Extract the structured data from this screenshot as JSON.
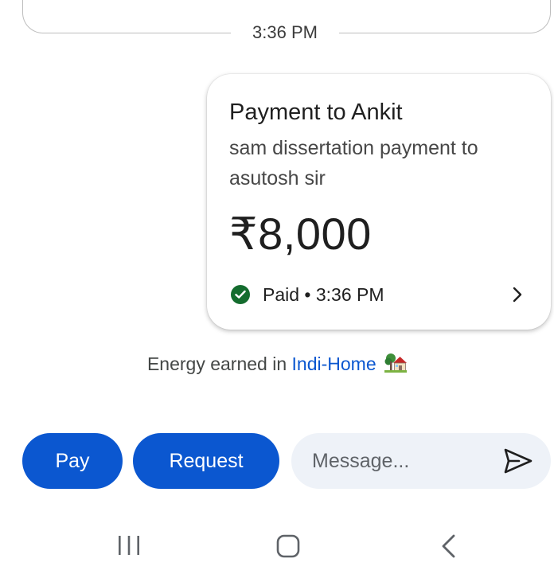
{
  "timestamp": "3:36 PM",
  "payment_card": {
    "title": "Payment to Ankit",
    "note": "sam dissertation payment to asutosh sir",
    "amount": "₹8,000",
    "status": "Paid • 3:36 PM",
    "status_icon": "check-circle-icon",
    "status_color": "#146c2e"
  },
  "energy": {
    "prefix": "Energy earned in ",
    "link": "Indi-Home",
    "icon": "house-with-garden-emoji"
  },
  "actions": {
    "pay_label": "Pay",
    "request_label": "Request",
    "message_placeholder": "Message...",
    "send_icon": "send-icon",
    "accent_color": "#0b57d0"
  },
  "system_nav": {
    "recents_icon": "recents-icon",
    "home_icon": "home-icon",
    "back_icon": "back-icon"
  }
}
